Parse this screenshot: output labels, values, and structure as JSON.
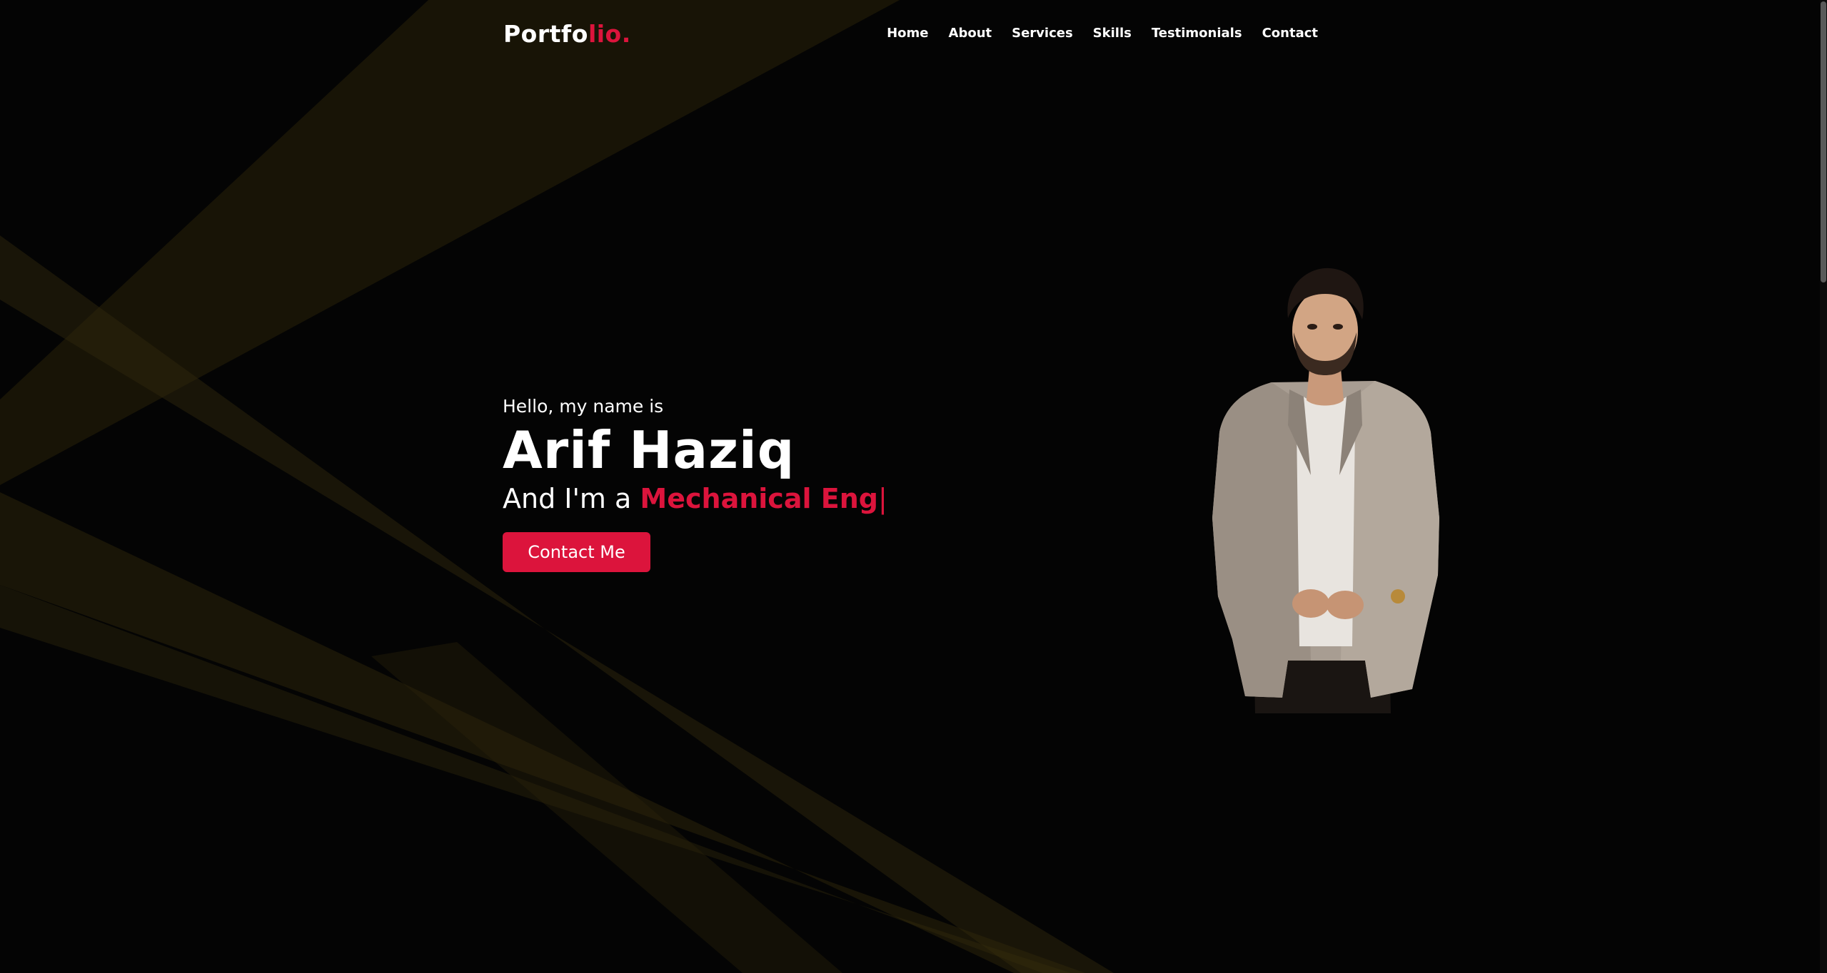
{
  "logo": {
    "part1": "Portfo",
    "part2": "lio."
  },
  "nav": {
    "items": [
      {
        "label": "Home"
      },
      {
        "label": "About"
      },
      {
        "label": "Services"
      },
      {
        "label": "Skills"
      },
      {
        "label": "Testimonials"
      },
      {
        "label": "Contact"
      }
    ]
  },
  "hero": {
    "greeting": "Hello, my name is",
    "name": "Arif Haziq",
    "role_prefix": "And I'm a",
    "role_typed": "Mechanical Eng",
    "cursor": "|",
    "cta_label": "Contact Me"
  },
  "colors": {
    "background": "#040404",
    "accent": "#dc143c",
    "text": "#ffffff",
    "ray": "#3a2f0a"
  }
}
